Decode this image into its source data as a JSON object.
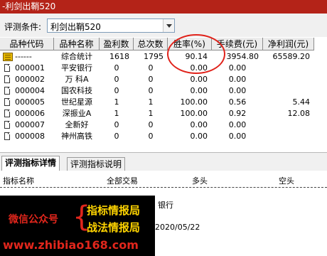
{
  "window": {
    "title": "-利剑出鞘520"
  },
  "condition": {
    "label": "评测条件:",
    "value": "利剑出鞘520"
  },
  "table": {
    "columns": [
      "品种代码",
      "品种名称",
      "盈利数",
      "总次数",
      "胜率(%)",
      "手续费(元)",
      "净利润(元)"
    ],
    "summary": {
      "code": "------",
      "name": "综合统计",
      "wins": "1618",
      "total": "1795",
      "winrate": "90.14",
      "fee": "3954.80",
      "profit": "65589.20"
    },
    "rows": [
      {
        "code": "000001",
        "name": "平安银行",
        "wins": "0",
        "total": "0",
        "winrate": "0.00",
        "fee": "0.00",
        "profit": ""
      },
      {
        "code": "000002",
        "name": "万 科A",
        "wins": "0",
        "total": "0",
        "winrate": "0.00",
        "fee": "0.00",
        "profit": ""
      },
      {
        "code": "000004",
        "name": "国农科技",
        "wins": "0",
        "total": "0",
        "winrate": "0.00",
        "fee": "0.00",
        "profit": ""
      },
      {
        "code": "000005",
        "name": "世纪星源",
        "wins": "1",
        "total": "1",
        "winrate": "100.00",
        "fee": "0.56",
        "profit": "5.44"
      },
      {
        "code": "000006",
        "name": "深振业A",
        "wins": "1",
        "total": "1",
        "winrate": "100.00",
        "fee": "0.92",
        "profit": "12.08"
      },
      {
        "code": "000007",
        "name": "全新好",
        "wins": "0",
        "total": "0",
        "winrate": "0.00",
        "fee": "0.00",
        "profit": ""
      },
      {
        "code": "000008",
        "name": "神州高铁",
        "wins": "0",
        "total": "0",
        "winrate": "0.00",
        "fee": "0.00",
        "profit": ""
      }
    ]
  },
  "tabs": [
    "评测指标详情",
    "评测指标说明"
  ],
  "detail": {
    "headers": [
      "指标名称",
      "全部交易",
      "多头",
      "空头"
    ],
    "bank_text": "银行",
    "date_text": "2020/05/22"
  },
  "watermark": {
    "left": "微信公众号",
    "right1": "指标情报局",
    "right2": "战法情报局",
    "url": "www.zhibiao168.com"
  },
  "colors": {
    "title_bar": "#b42318",
    "accent_red": "#e0221a",
    "watermark_yellow": "#ffd400"
  }
}
